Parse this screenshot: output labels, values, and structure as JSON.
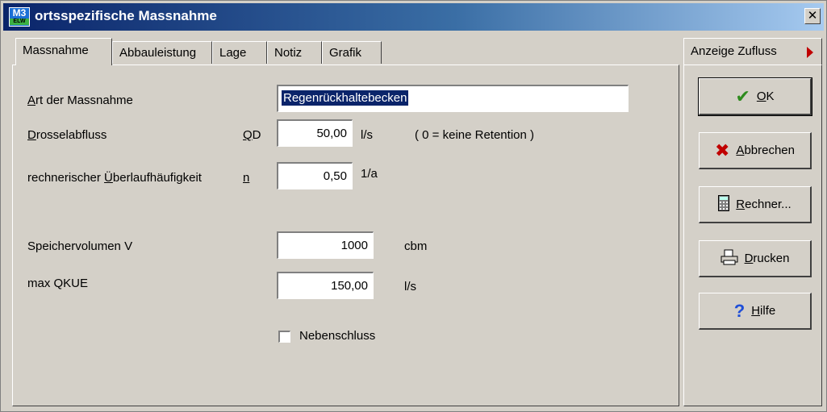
{
  "window": {
    "title": "ortsspezifische Massnahme",
    "app_icon": {
      "name": "m3-app-icon",
      "text": "M3",
      "sub": "ELW"
    }
  },
  "tabs": [
    {
      "label": "Massnahme",
      "active": true
    },
    {
      "label": "Abbauleistung",
      "active": false
    },
    {
      "label": "Lage",
      "active": false
    },
    {
      "label": "Notiz",
      "active": false
    },
    {
      "label": "Grafik",
      "active": false
    }
  ],
  "form": {
    "art_label": "Art der Massnahme",
    "art_value": "Regenrückhaltebecken",
    "drossel_label": "Drosselabfluss",
    "drossel_symbol": "QD",
    "drossel_value": "50,00",
    "drossel_unit": "l/s",
    "drossel_note": "( 0 = keine Retention )",
    "ueberlauf_label": "rechnerischer Überlaufhäufigkeit",
    "ueberlauf_symbol": "n",
    "ueberlauf_value": "0,50",
    "ueberlauf_unit": "1/a",
    "speicher_label": "Speichervolumen V",
    "speicher_value": "1000",
    "speicher_unit": "cbm",
    "qkue_label": "max QKUE",
    "qkue_value": "150,00",
    "qkue_unit": "l/s",
    "nebenschluss_label": "Nebenschluss",
    "nebenschluss_checked": false
  },
  "side": {
    "anzeige_label": "Anzeige Zufluss",
    "buttons": {
      "ok": {
        "label": "OK",
        "icon": "checkmark-icon"
      },
      "abbrechen": {
        "label": "Abbrechen",
        "icon": "x-icon"
      },
      "rechner": {
        "label": "Rechner...",
        "icon": "calculator-icon"
      },
      "drucken": {
        "label": "Drucken",
        "icon": "printer-icon"
      },
      "hilfe": {
        "label": "Hilfe",
        "icon": "question-icon"
      }
    }
  },
  "colors": {
    "title_gradient_start": "#0a246a",
    "title_gradient_end": "#a6caf0",
    "ok_green": "#2e8b1e",
    "cancel_red": "#c00000",
    "help_blue": "#1f4fd8"
  }
}
